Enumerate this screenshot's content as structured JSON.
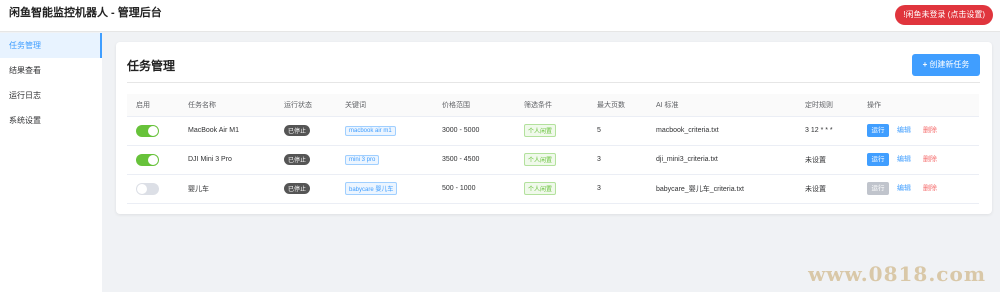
{
  "header": {
    "title": "闲鱼智能监控机器人 - 管理后台",
    "login_status": "!闲鱼未登录 (点击设置)"
  },
  "sidebar": {
    "items": [
      {
        "label": "任务管理",
        "active": true
      },
      {
        "label": "结果查看",
        "active": false
      },
      {
        "label": "运行日志",
        "active": false
      },
      {
        "label": "系统设置",
        "active": false
      }
    ]
  },
  "main": {
    "title": "任务管理",
    "create_button": "创建新任务",
    "columns": [
      "启用",
      "任务名称",
      "运行状态",
      "关键词",
      "价格范围",
      "筛选条件",
      "最大页数",
      "AI 标准",
      "定时规则",
      "操作"
    ],
    "rows": [
      {
        "enabled": true,
        "name": "MacBook Air M1",
        "status": "已停止",
        "keyword": "macbook air m1",
        "price": "3000 - 5000",
        "filter": "个人闲置",
        "pages": "5",
        "ai": "macbook_criteria.txt",
        "schedule": "3 12 * * *",
        "run": "运行",
        "run_enabled": true,
        "edit": "编辑",
        "delete": "删除"
      },
      {
        "enabled": true,
        "name": "DJI Mini 3 Pro",
        "status": "已停止",
        "keyword": "mini 3 pro",
        "price": "3500 - 4500",
        "filter": "个人闲置",
        "pages": "3",
        "ai": "dji_mini3_criteria.txt",
        "schedule": "未设置",
        "run": "运行",
        "run_enabled": true,
        "edit": "编辑",
        "delete": "删除"
      },
      {
        "enabled": false,
        "name": "婴儿车",
        "status": "已停止",
        "keyword": "babycare 婴儿车",
        "price": "500 - 1000",
        "filter": "个人闲置",
        "pages": "3",
        "ai": "babycare_婴儿车_criteria.txt",
        "schedule": "未设置",
        "run": "运行",
        "run_enabled": false,
        "edit": "编辑",
        "delete": "删除"
      }
    ]
  },
  "watermark": "www.0818.com",
  "colors": {
    "accent": "#409eff",
    "danger": "#e0353d",
    "success": "#67c23a"
  }
}
